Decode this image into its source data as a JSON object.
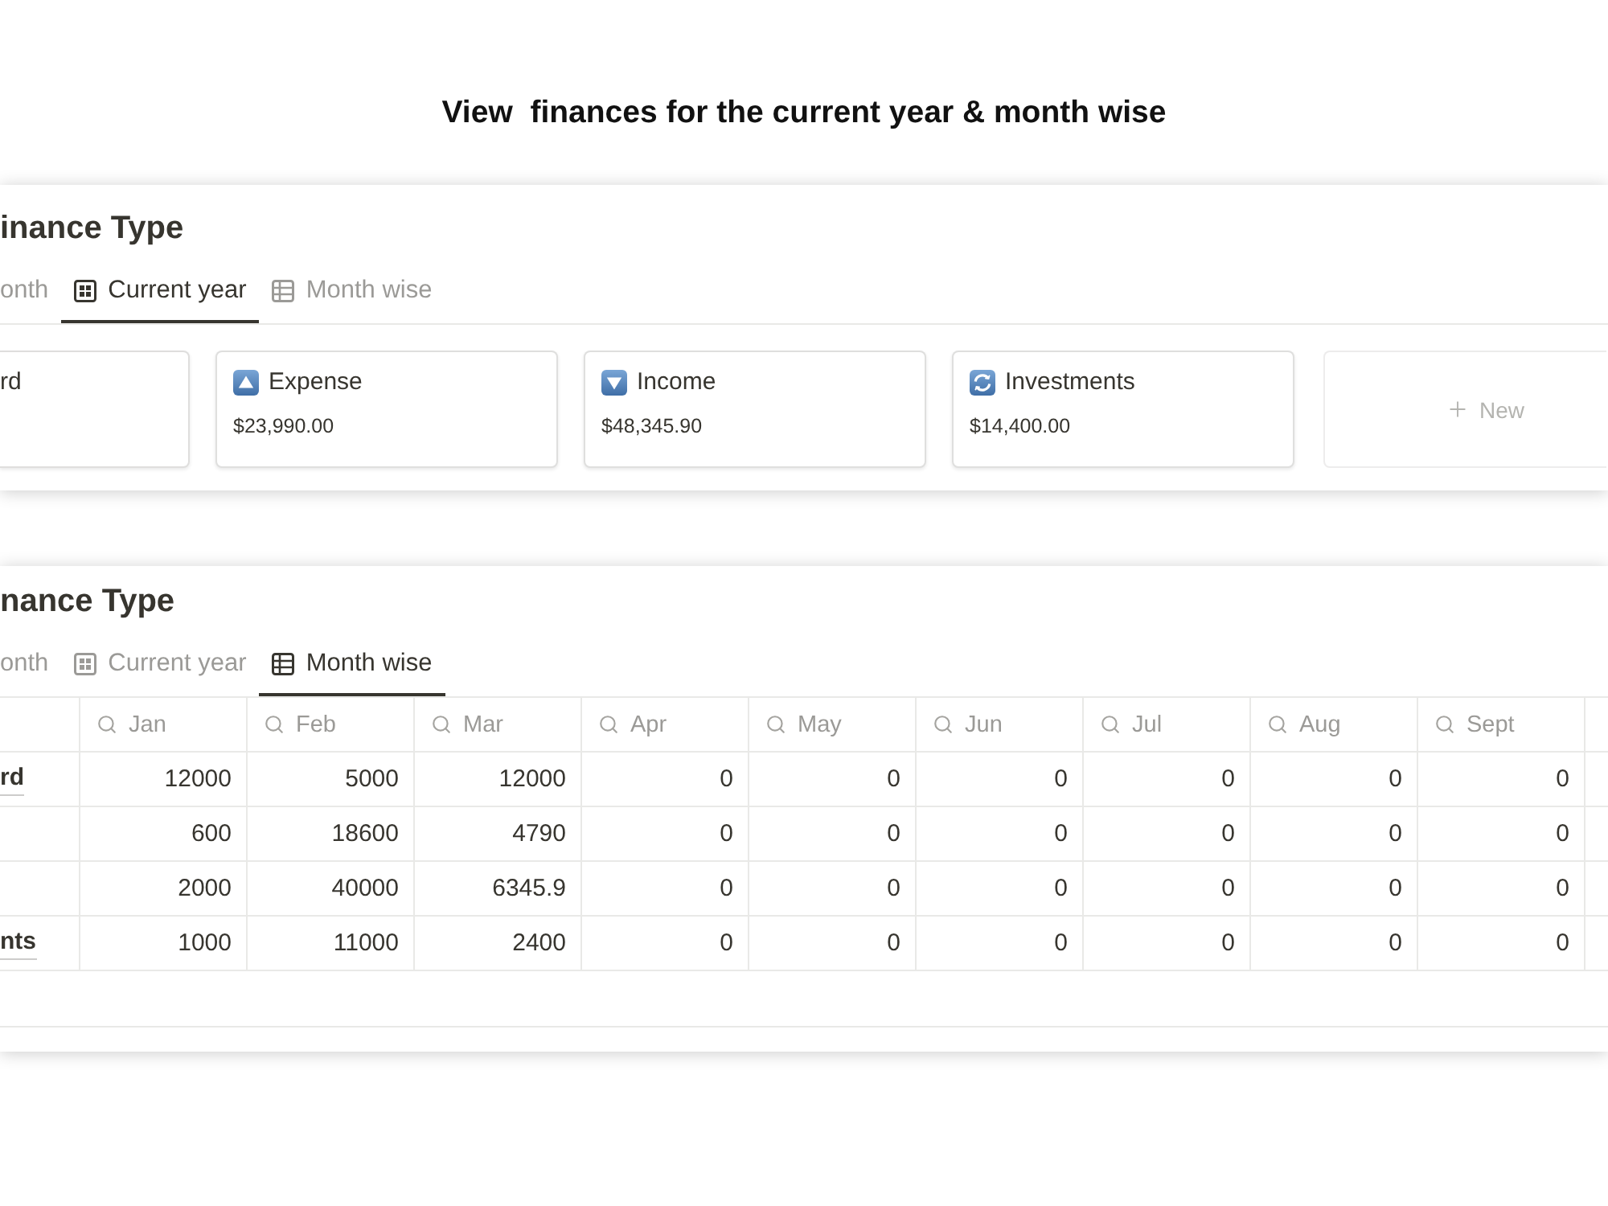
{
  "heading": "View  finances for the current year & month wise",
  "panels": [
    {
      "kind": "board",
      "title": "inance Type",
      "tabs": [
        {
          "kind": "text",
          "label": "onth",
          "selected": false
        },
        {
          "kind": "board",
          "label": "Current year",
          "selected": true
        },
        {
          "kind": "table",
          "label": "Month wise",
          "selected": false
        }
      ],
      "cards": [
        {
          "kind": "text",
          "name": "rd"
        },
        {
          "kind": "up",
          "name": "Expense",
          "amount": "$23,990.00"
        },
        {
          "kind": "down",
          "name": "Income",
          "amount": "$48,345.90"
        },
        {
          "kind": "cycle",
          "name": "Investments",
          "amount": "$14,400.00"
        }
      ],
      "new_card": {
        "label": "New"
      }
    },
    {
      "kind": "table",
      "title": "nance Type",
      "tabs": [
        {
          "kind": "text",
          "label": "onth",
          "selected": false
        },
        {
          "kind": "board",
          "label": "Current year",
          "selected": false
        },
        {
          "kind": "table",
          "label": "Month wise",
          "selected": true
        }
      ],
      "table": {
        "columns": [
          "Jan",
          "Feb",
          "Mar",
          "Apr",
          "May",
          "Jun",
          "Jul",
          "Aug",
          "Sept"
        ],
        "rows": [
          {
            "title": "rd",
            "cells": [
              "12000",
              "5000",
              "12000",
              "0",
              "0",
              "0",
              "0",
              "0",
              "0"
            ]
          },
          {
            "cells": [
              "600",
              "18600",
              "4790",
              "0",
              "0",
              "0",
              "0",
              "0",
              "0"
            ]
          },
          {
            "cells": [
              "2000",
              "40000",
              "6345.9",
              "0",
              "0",
              "0",
              "0",
              "0",
              "0"
            ]
          },
          {
            "title": "nts",
            "cells": [
              "1000",
              "11000",
              "2400",
              "0",
              "0",
              "0",
              "0",
              "0",
              "0"
            ]
          }
        ]
      }
    }
  ]
}
